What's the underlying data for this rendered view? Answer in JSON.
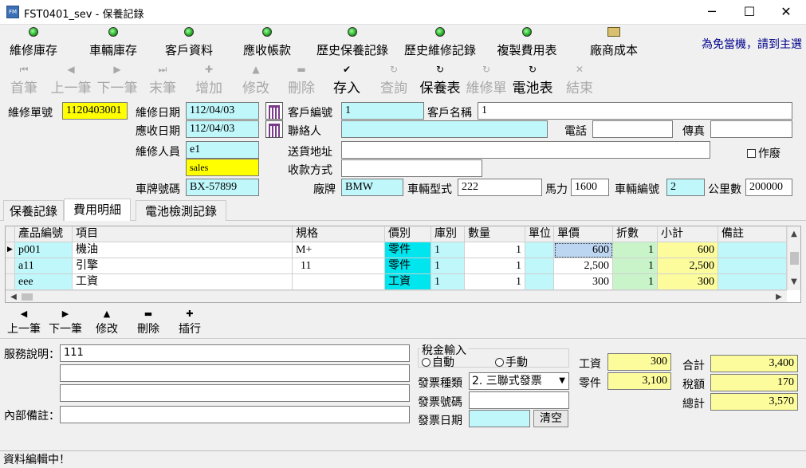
{
  "window": {
    "title": "FST0401_sev - 保養記錄",
    "app_icon": "app-icon",
    "minimize": "─",
    "maximize": "☐",
    "close": "✕"
  },
  "menubar": {
    "items": [
      "維修庫存",
      "車輛庫存",
      "客戶資料",
      "應收帳款",
      "歷史保養記錄",
      "歷史維修記錄",
      "複製費用表",
      "廠商成本"
    ],
    "notice": "為免當機，請到主選"
  },
  "toolbar": {
    "first": "首筆",
    "prev": "上一筆",
    "next": "下一筆",
    "last": "末筆",
    "add": "增加",
    "edit": "修改",
    "delete": "刪除",
    "save": "存入",
    "query": "查詢",
    "maint": "保養表",
    "repair": "維修單",
    "battery": "電池表",
    "exit": "結束"
  },
  "header": {
    "order_no_label": "維修單號",
    "order_no": "1120403001",
    "repair_date_label": "維修日期",
    "repair_date": "112/04/03",
    "receivable_date_label": "應收日期",
    "receivable_date": "112/04/03",
    "staff_label": "維修人員",
    "staff": "e1",
    "staff_name": "sales",
    "plate_label": "車牌號碼",
    "plate": "BX-57899",
    "customer_no_label": "客戶編號",
    "customer_no": "1",
    "customer_name_label": "客戶名稱",
    "customer_name": "1",
    "contact_label": "聯絡人",
    "contact": "",
    "phone_label": "電話",
    "phone": "",
    "fax_label": "傳真",
    "fax": "",
    "address_label": "送貨地址",
    "address": "",
    "payment_label": "收款方式",
    "payment": "",
    "void_label": "作廢",
    "brand_label": "廠牌",
    "brand": "BMW",
    "model_label": "車輛型式",
    "model": "222",
    "hp_label": "馬力",
    "hp": "1600",
    "vehicle_no_label": "車輛編號",
    "vehicle_no": "2",
    "mileage_label": "公里數",
    "mileage": "200000"
  },
  "tabs": [
    "保養記錄",
    "費用明細",
    "電池檢測記錄"
  ],
  "grid": {
    "columns": [
      "產品編號",
      "項目",
      "規格",
      "價別",
      "庫別",
      "數量",
      "單位",
      "單價",
      "折數",
      "小計",
      "備註"
    ],
    "rows": [
      {
        "code": "p001",
        "item": "機油",
        "spec": "M+",
        "price_type": "零件",
        "warehouse": "1",
        "qty": "1",
        "unit": "",
        "price": "600",
        "discount": "1",
        "subtotal": "600",
        "note": ""
      },
      {
        "code": "a11",
        "item": "引擎",
        "spec": "11",
        "price_type": "零件",
        "warehouse": "1",
        "qty": "1",
        "unit": "",
        "price": "2,500",
        "discount": "1",
        "subtotal": "2,500",
        "note": ""
      },
      {
        "code": "eee",
        "item": "工資",
        "spec": "",
        "price_type": "工資",
        "warehouse": "1",
        "qty": "1",
        "unit": "",
        "price": "300",
        "discount": "1",
        "subtotal": "300",
        "note": ""
      }
    ]
  },
  "rownav": {
    "prev": "上一筆",
    "next": "下一筆",
    "edit": "修改",
    "delete": "刪除",
    "insert": "插行"
  },
  "footer": {
    "service_label": "服務說明：",
    "service": "111",
    "internal_label": "內部備註：",
    "internal": "",
    "tax_group_label": "稅金輸入",
    "tax_auto": "自動",
    "tax_manual": "手動",
    "invoice_type_label": "發票種類",
    "invoice_type": "2. 三聯式發票",
    "invoice_no_label": "發票號碼",
    "invoice_no": "",
    "invoice_date_label": "發票日期",
    "invoice_date": "",
    "clear": "清空",
    "labor_label": "工資",
    "labor": "300",
    "parts_label": "零件",
    "parts": "3,100",
    "total_label": "合計",
    "total": "3,400",
    "tax_label": "稅額",
    "tax": "170",
    "grand_label": "總計",
    "grand": "3,570"
  },
  "status": "資料編輯中！"
}
